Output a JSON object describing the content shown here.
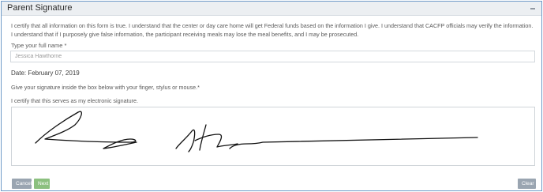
{
  "panel": {
    "title": "Parent Signature",
    "collapse_icon": "minus-icon"
  },
  "form": {
    "certify_text": "I certify that all information on this form is true. I understand that the center or day care home will get Federal funds based on the information I give. I understand that CACFP officials may verify the information. I understand that if I purposely give false information, the participant receiving meals may lose the meal benefits, and I may be prosecuted.",
    "name_label": "Type your full name *",
    "name_value": "Jessica Hawthorne",
    "date_text": "Date: February 07, 2019",
    "signature_instruction": "Give your signature inside the box below with your finger, stylus or mouse.*",
    "electronic_signature_text": "I certify that this serves as my electronic signature."
  },
  "buttons": {
    "cancel": "Cancel",
    "next": "Next",
    "clear": "Clear"
  },
  "colors": {
    "frame_border": "#6f9bc8",
    "header_bg": "#eceff2",
    "next_button": "#8cc07f",
    "cancel_button": "#9aa5b1",
    "clear_button": "#9aa5b1"
  }
}
